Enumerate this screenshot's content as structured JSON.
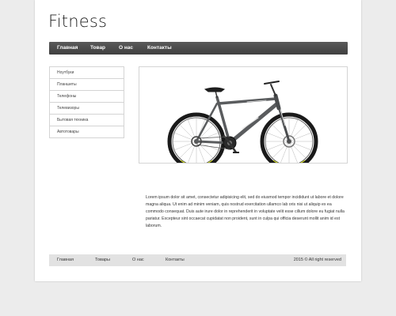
{
  "site": {
    "title": "Fitness"
  },
  "nav": {
    "items": [
      {
        "label": "Главная"
      },
      {
        "label": "Товар"
      },
      {
        "label": "О нас"
      },
      {
        "label": "Контакты"
      }
    ]
  },
  "sidebar": {
    "items": [
      {
        "label": "Ноутбуки"
      },
      {
        "label": "Планшеты"
      },
      {
        "label": "Телефоны"
      },
      {
        "label": "Телевизоры"
      },
      {
        "label": "Бытовая техника"
      },
      {
        "label": "Автотовары"
      }
    ]
  },
  "product": {
    "image": "mountain-bike-image",
    "description": "Lorem ipsum dolor sit amet, consectetur adipisicing elit, sed do eiusmod tempor incididunt ut labore et dolore magna aliqua. Ut enim ad minim veniam, quis nostrud exercitation ullamco lab oris nisi ut aliquip ex ea commodo consequat. Duis aute irure dolor in reprehenderit in voluptate velit esse cillum dolore eu fugiat nulla pariatur. Excepteur sint occaecat cupidatat non proident, sunt in culpa qui officia deserunt mollit anim id est laborum."
  },
  "footer": {
    "items": [
      {
        "label": "Главная"
      },
      {
        "label": "Товары"
      },
      {
        "label": "О нас"
      },
      {
        "label": "Контакты"
      }
    ],
    "copyright": "2015 © All right reserved"
  },
  "colors": {
    "nav_bg": "#4a4a4a",
    "footer_bg": "#e2e2e2",
    "page_bg": "#ececec",
    "bike_frame": "#5a5c5e",
    "bike_accent": "#c8d400"
  }
}
